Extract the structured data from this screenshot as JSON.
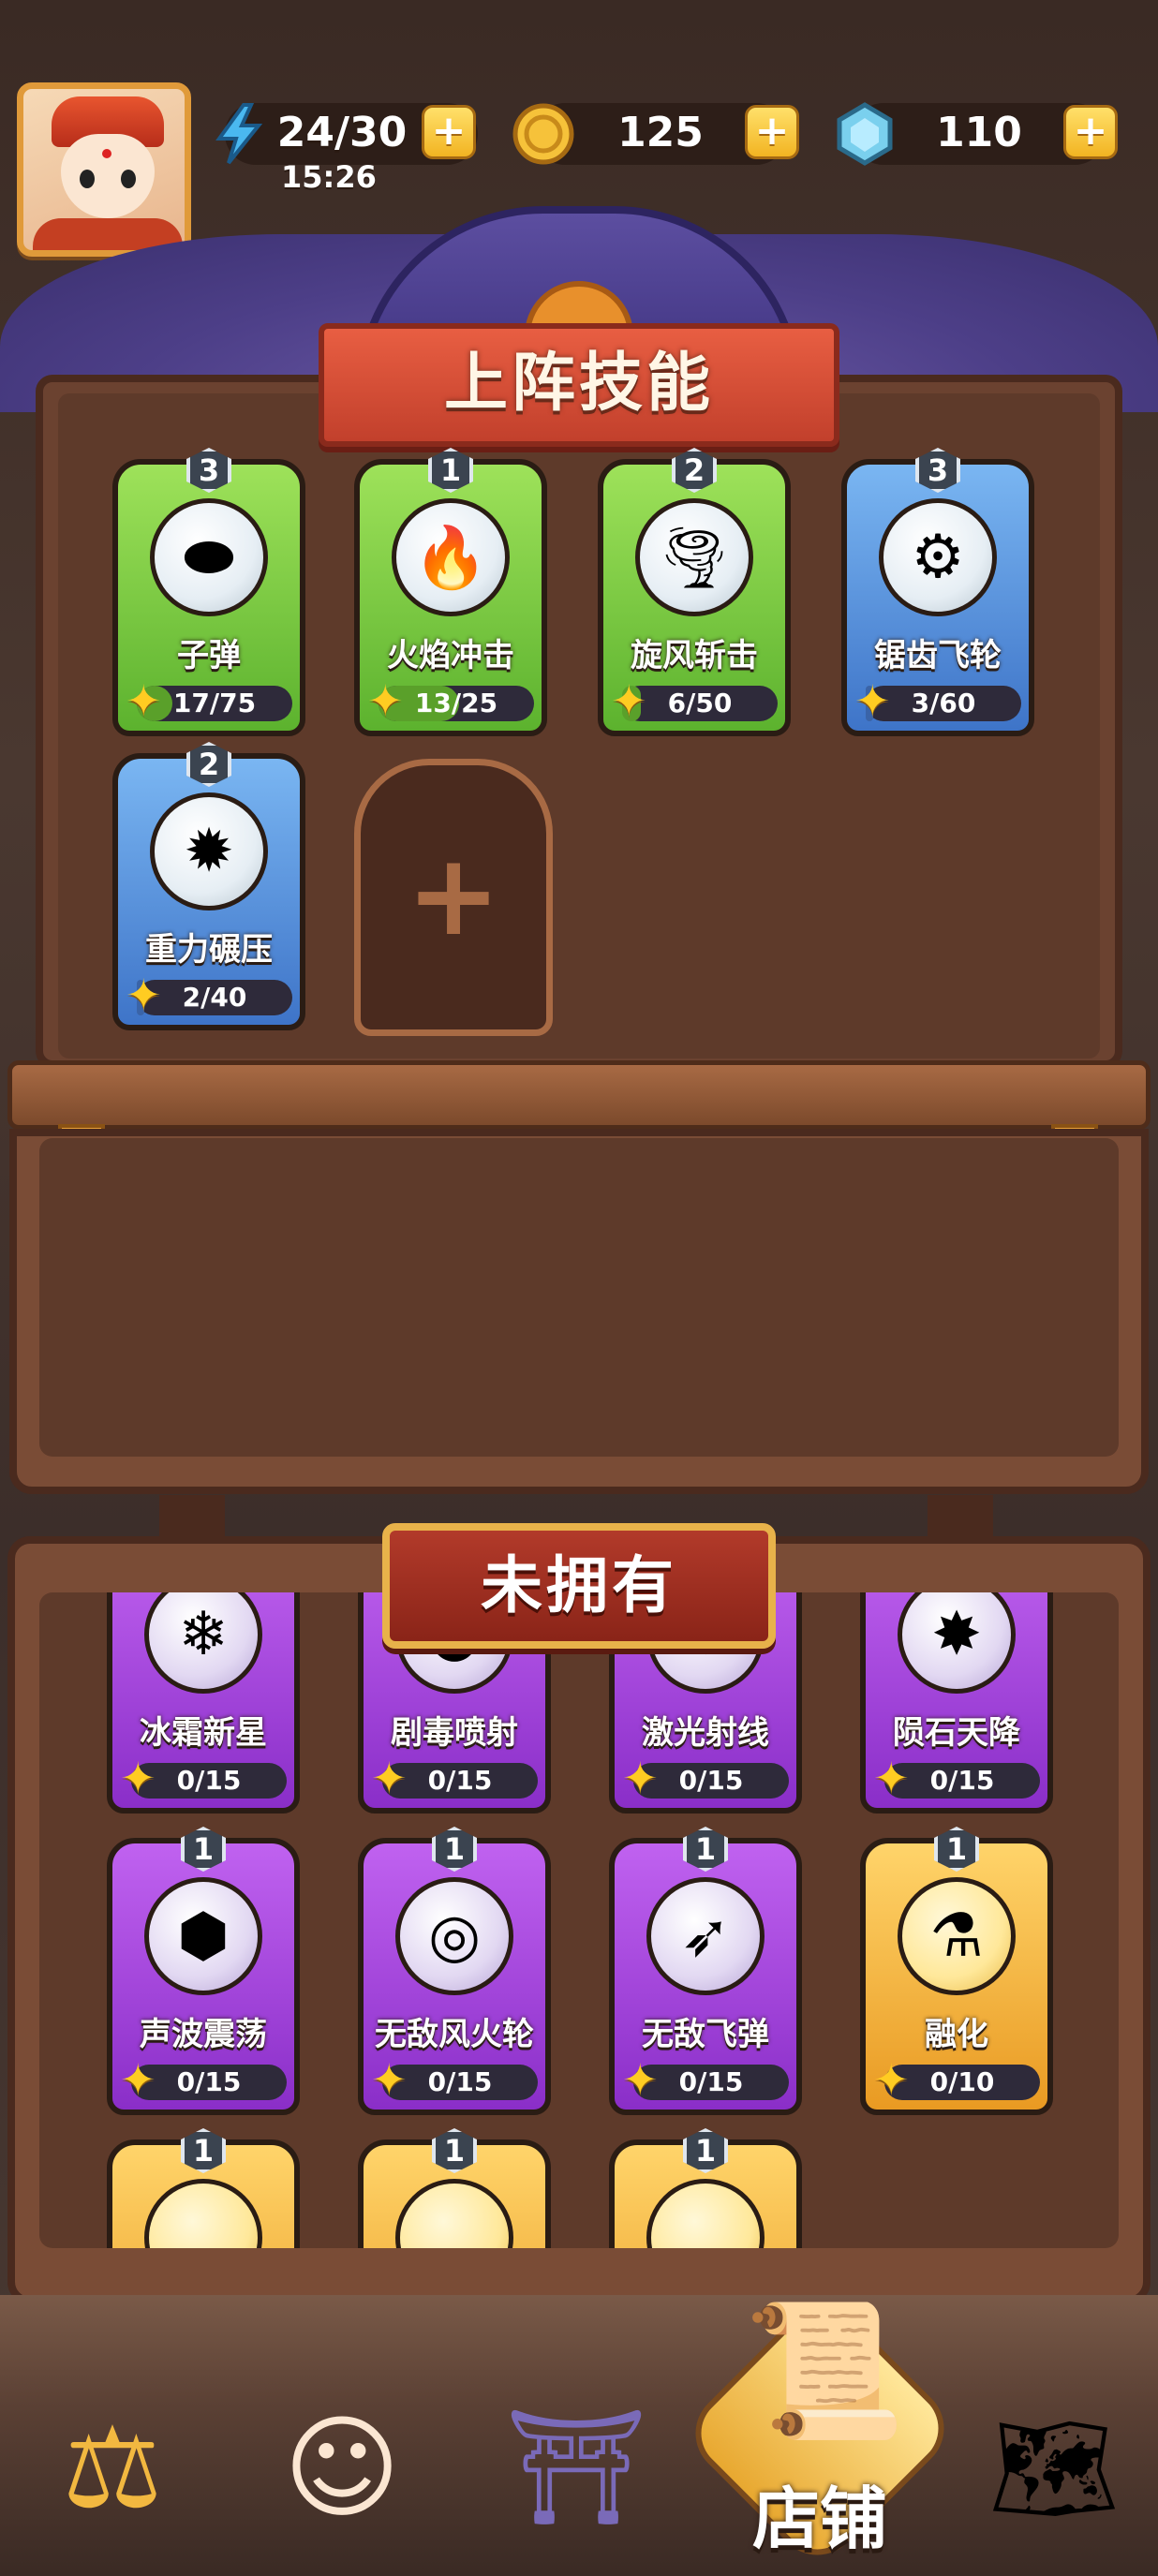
{
  "top_bar": {
    "energy": "24/30",
    "energy_timer": "15:26",
    "gold": "125",
    "gems": "110",
    "plus": "+"
  },
  "equipped": {
    "title": "上阵技能",
    "add_symbol": "+",
    "skills": [
      {
        "name": "子弹",
        "level": "3",
        "progress": "17/75",
        "fraction": 0.227,
        "rarity": "green",
        "icon": "bullet-icon",
        "glyph": "⬬"
      },
      {
        "name": "火焰冲击",
        "level": "1",
        "progress": "13/25",
        "fraction": 0.52,
        "rarity": "green",
        "icon": "fire-staff-icon",
        "glyph": "🔥"
      },
      {
        "name": "旋风斩击",
        "level": "2",
        "progress": "6/50",
        "fraction": 0.12,
        "rarity": "green",
        "icon": "tornado-icon",
        "glyph": "🌪"
      },
      {
        "name": "锯齿飞轮",
        "level": "3",
        "progress": "3/60",
        "fraction": 0.05,
        "rarity": "blue",
        "icon": "saw-wheel-icon",
        "glyph": "⚙"
      },
      {
        "name": "重力碾压",
        "level": "2",
        "progress": "2/40",
        "fraction": 0.05,
        "rarity": "blue",
        "icon": "spiked-mace-icon",
        "glyph": "✹"
      }
    ]
  },
  "unowned": {
    "title": "未拥有",
    "skills": [
      {
        "name": "冰霜新星",
        "level": "",
        "progress": "0/15",
        "rarity": "purple",
        "icon": "frost-nova-icon",
        "glyph": "❄"
      },
      {
        "name": "剧毒喷射",
        "level": "",
        "progress": "0/15",
        "rarity": "purple",
        "icon": "poison-orb-icon",
        "glyph": "●"
      },
      {
        "name": "激光射线",
        "level": "",
        "progress": "0/15",
        "rarity": "purple",
        "icon": "laser-gun-icon",
        "glyph": "✦"
      },
      {
        "name": "陨石天降",
        "level": "",
        "progress": "0/15",
        "rarity": "purple",
        "icon": "meteor-icon",
        "glyph": "✸"
      },
      {
        "name": "声波震荡",
        "level": "1",
        "progress": "0/15",
        "rarity": "purple",
        "icon": "sonic-cube-icon",
        "glyph": "⬢"
      },
      {
        "name": "无敌风火轮",
        "level": "1",
        "progress": "0/15",
        "rarity": "purple",
        "icon": "fire-wheel-icon",
        "glyph": "◎"
      },
      {
        "name": "无敌飞弹",
        "level": "1",
        "progress": "0/15",
        "rarity": "purple",
        "icon": "missile-icon",
        "glyph": "➶"
      },
      {
        "name": "融化",
        "level": "1",
        "progress": "0/10",
        "rarity": "gold",
        "icon": "potion-icon",
        "glyph": "⚗"
      },
      {
        "name": "",
        "level": "1",
        "progress": "",
        "rarity": "gold",
        "icon": "gold-skill-icon",
        "glyph": ""
      },
      {
        "name": "",
        "level": "1",
        "progress": "",
        "rarity": "gold",
        "icon": "gold-skill-icon",
        "glyph": ""
      },
      {
        "name": "",
        "level": "1",
        "progress": "",
        "rarity": "gold",
        "icon": "gold-skill-icon",
        "glyph": ""
      }
    ]
  },
  "nav": {
    "items": [
      {
        "icon": "scales-icon",
        "glyph": "⚖"
      },
      {
        "icon": "hero-icon",
        "glyph": "☺"
      },
      {
        "icon": "temple-icon",
        "glyph": "⛩"
      },
      {
        "icon": "scroll-icon",
        "glyph": "📜"
      },
      {
        "icon": "map-icon",
        "glyph": "🗺"
      }
    ],
    "active_label": "店铺"
  },
  "colors": {
    "green_card": "#5cb22e",
    "blue_card": "#3e74c8",
    "purple_card": "#8a2ec8",
    "gold_card": "#e99a22",
    "banner_red": "#c2402c"
  }
}
